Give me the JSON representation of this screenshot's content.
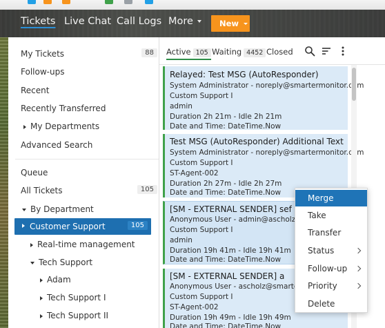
{
  "colors": {
    "accent_blue": "#1e6fb0",
    "new_button": "#f7941d",
    "status_green": "#3fa14a",
    "card_bg": "#dbeaf7"
  },
  "nav": {
    "items": [
      {
        "label": "Tickets",
        "active": true
      },
      {
        "label": "Live Chat"
      },
      {
        "label": "Call Logs"
      },
      {
        "label": "More"
      }
    ],
    "new_button": "New"
  },
  "sidebar": {
    "my_tickets": {
      "label": "My Tickets",
      "count": "88"
    },
    "follow_ups": "Follow-ups",
    "recent": "Recent",
    "recently_transferred": "Recently Transferred",
    "my_departments": "My Departments",
    "advanced_search": "Advanced Search",
    "queue": "Queue",
    "all_tickets": {
      "label": "All Tickets",
      "count": "105"
    },
    "by_department": "By Department",
    "customer_support": {
      "label": "Customer Support",
      "count": "105"
    },
    "realtime_management": "Real-time management",
    "tech_support": "Tech Support",
    "adam": "Adam",
    "tech_support_1": "Tech Support I",
    "tech_support_2": "Tech Support II"
  },
  "tabs": [
    {
      "label": "Active",
      "count": "105",
      "active": true
    },
    {
      "label": "Waiting",
      "count": "4452"
    },
    {
      "label": "Closed"
    }
  ],
  "toolbar_icons": [
    "search-icon",
    "sort-icon",
    "kebab-menu-icon"
  ],
  "tickets": [
    {
      "subject": "Relayed: Test MSG (AutoResponder)",
      "from": "System Administrator - noreply@smartermonitor.com",
      "department": "Custom Support I",
      "agent": "admin",
      "duration": "Duration 2h 21m - Idle 2h 21m",
      "datetime": "Date and Time: DateTime.Now"
    },
    {
      "subject": "Test MSG (AutoResponder) Additional Text",
      "from": "System Administrator - noreply@smartermonitor.com",
      "department": "Custom Support I",
      "agent": "ST-Agent-002",
      "duration": "Duration 2h 27m - Idle 2h 27m",
      "datetime": "Date and Time: DateTime.Now"
    },
    {
      "subject": "[SM - EXTERNAL SENDER] sef",
      "from": "Anonymous User - admin@ascholz.io",
      "department": "Custom Support I",
      "agent": "admin",
      "duration": "Duration 19h 41m - Idle 19h 41m",
      "datetime": "Date and Time: DateTime.Now"
    },
    {
      "subject": "[SM - EXTERNAL SENDER] a",
      "from": "Anonymous User - ascholz@smartertoo",
      "department": "Custom Support I",
      "agent": "ST-Agent-002",
      "duration": "Duration 19h 49m - Idle 19h 49m",
      "datetime": "Date and Time: DateTime.Now"
    }
  ],
  "context_menu": [
    {
      "label": "Merge",
      "highlighted": true
    },
    {
      "label": "Take"
    },
    {
      "label": "Transfer"
    },
    {
      "label": "Status",
      "submenu": true
    },
    {
      "label": "Follow-up",
      "submenu": true
    },
    {
      "label": "Priority",
      "submenu": true
    },
    {
      "label": "Delete"
    }
  ]
}
